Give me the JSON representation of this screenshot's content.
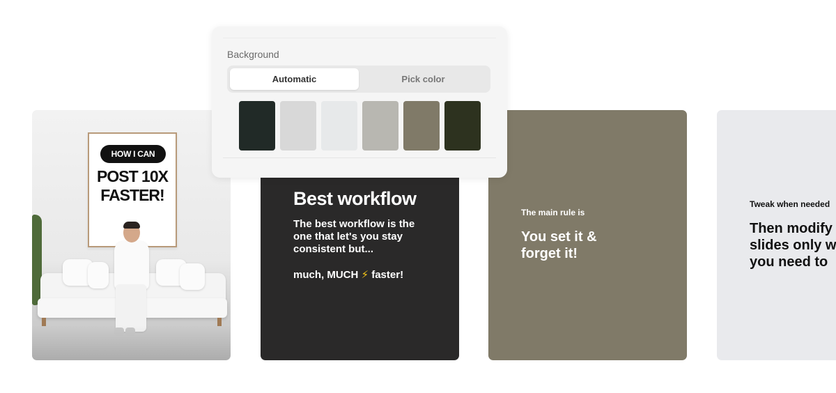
{
  "panel": {
    "label": "Background",
    "tabs": [
      "Automatic",
      "Pick color"
    ],
    "active_tab": "Automatic",
    "swatches": [
      "#212a27",
      "#d8d8d8",
      "#e7e9ea",
      "#b8b7b1",
      "#807a68",
      "#2d321f"
    ]
  },
  "slides": [
    {
      "pill": "HOW I CAN",
      "poster_line1": "POST 10X",
      "poster_line2": "FASTER!"
    },
    {
      "background": "#2a2929",
      "title": "Best workflow",
      "body": "The best workflow is the one that let's you stay consistent but...",
      "body2_prefix": "much, MUCH ",
      "body2_icon": "⚡",
      "body2_suffix": " faster!"
    },
    {
      "background": "#807a68",
      "small": "The main rule is",
      "big": "You set it & forget it!"
    },
    {
      "background": "#e9eaed",
      "small": "Tweak when needed",
      "big": "Then modify slides only when you need to"
    }
  ]
}
